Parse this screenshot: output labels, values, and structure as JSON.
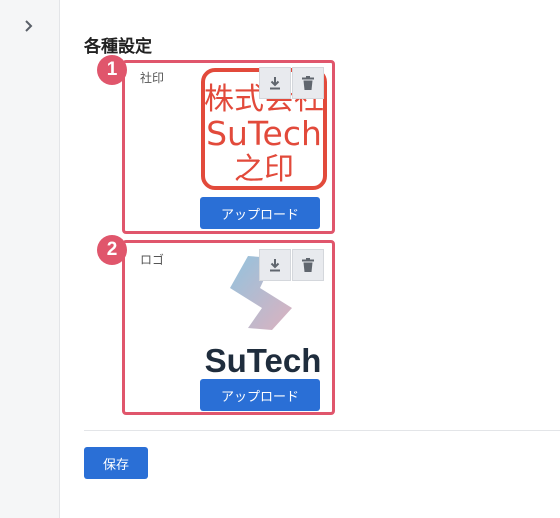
{
  "section": {
    "title": "各種設定"
  },
  "fields": [
    {
      "badge": "1",
      "label": "社印",
      "image_icon": "company-seal-image",
      "stamp_lines": [
        "株式会社",
        "SuTech",
        "之印"
      ],
      "stamp_color": "#e24a3b",
      "upload_label": "アップロード"
    },
    {
      "badge": "2",
      "label": "ロゴ",
      "image_icon": "logo-image",
      "logo_text": "SuTech",
      "upload_label": "アップロード"
    }
  ],
  "actions": {
    "save_label": "保存"
  },
  "icons": {
    "sidebar_toggle": "chevron-right-icon",
    "download": "download-icon",
    "delete": "trash-icon"
  },
  "colors": {
    "accent": "#2a6fd6",
    "highlight": "#e0566c",
    "logo_text": "#1f2d3d"
  }
}
